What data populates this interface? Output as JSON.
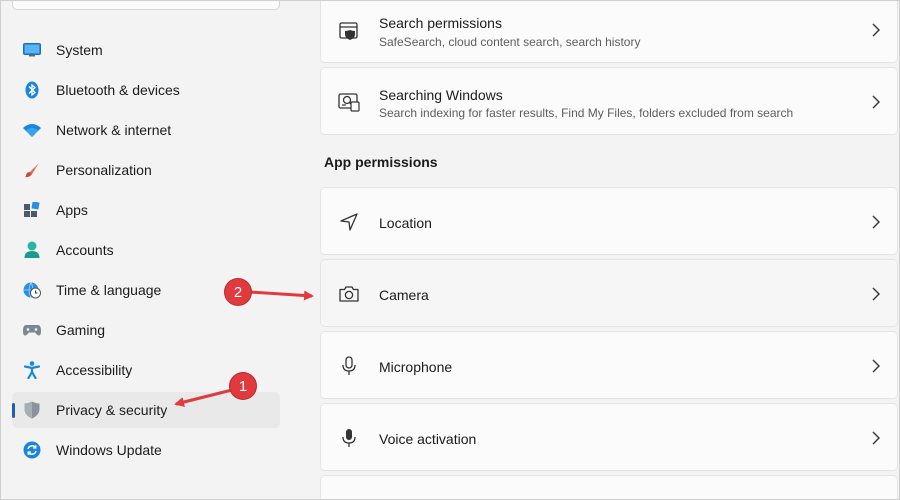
{
  "sidebar": {
    "items": [
      {
        "label": "System",
        "icon": "monitor-icon"
      },
      {
        "label": "Bluetooth & devices",
        "icon": "bluetooth-icon"
      },
      {
        "label": "Network & internet",
        "icon": "wifi-icon"
      },
      {
        "label": "Personalization",
        "icon": "brush-icon"
      },
      {
        "label": "Apps",
        "icon": "apps-icon"
      },
      {
        "label": "Accounts",
        "icon": "person-icon"
      },
      {
        "label": "Time & language",
        "icon": "globe-clock-icon"
      },
      {
        "label": "Gaming",
        "icon": "gamepad-icon"
      },
      {
        "label": "Accessibility",
        "icon": "accessibility-icon"
      },
      {
        "label": "Privacy & security",
        "icon": "shield-icon",
        "selected": true
      },
      {
        "label": "Windows Update",
        "icon": "update-icon"
      }
    ]
  },
  "main": {
    "search_permissions": {
      "title": "Search permissions",
      "subtitle": "SafeSearch, cloud content search, search history",
      "icon": "search-shield-icon"
    },
    "searching_windows": {
      "title": "Searching Windows",
      "subtitle": "Search indexing for faster results, Find My Files, folders excluded from search",
      "icon": "search-indexing-icon"
    },
    "section_label": "App permissions",
    "app_permissions": [
      {
        "label": "Location",
        "icon": "location-icon"
      },
      {
        "label": "Camera",
        "icon": "camera-icon"
      },
      {
        "label": "Microphone",
        "icon": "microphone-icon"
      },
      {
        "label": "Voice activation",
        "icon": "voice-activation-icon"
      }
    ]
  },
  "annotations": {
    "badge_1": "1",
    "badge_2": "2",
    "color": "#e03a3e"
  },
  "colors": {
    "accent": "#1f5fae",
    "background": "#f3f3f3",
    "card": "#fbfbfb"
  }
}
